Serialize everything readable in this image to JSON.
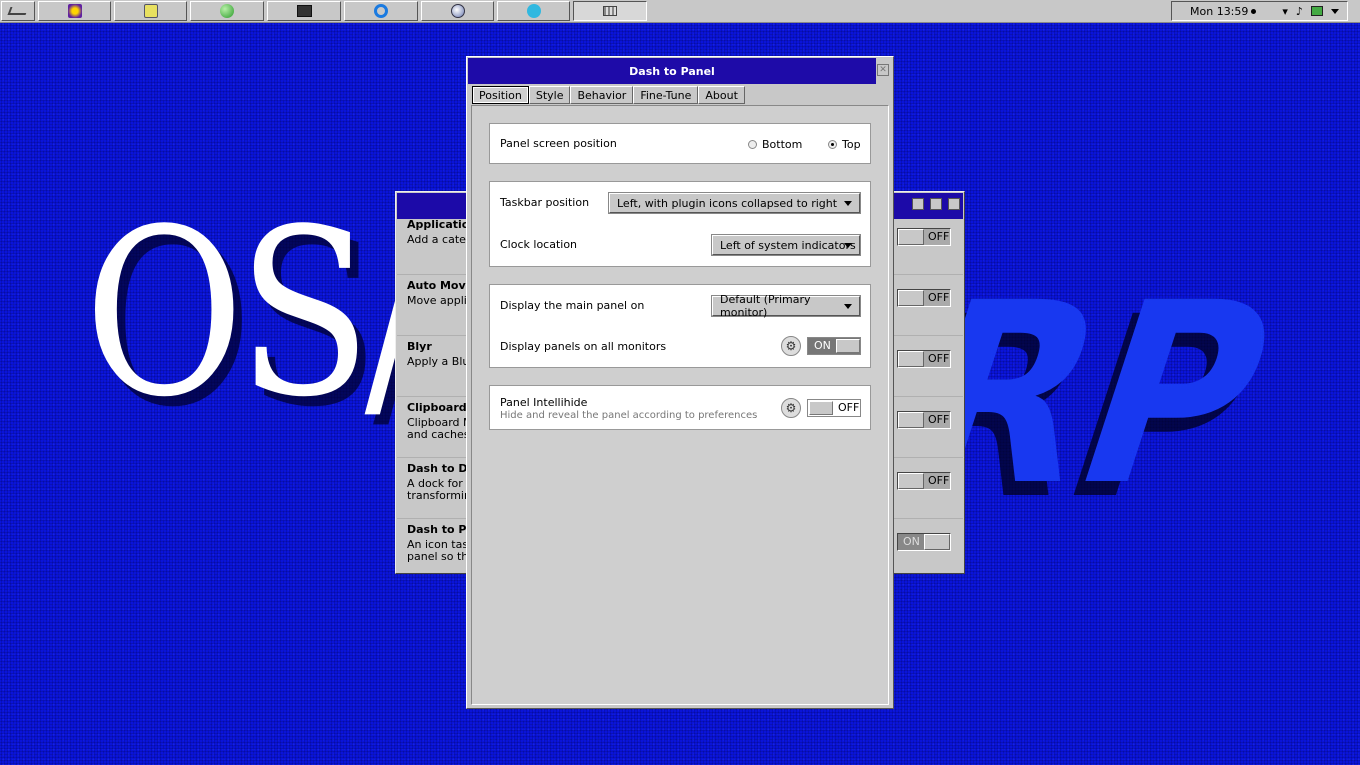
{
  "taskbar": {
    "clock": "Mon 13:59",
    "apps": [
      {
        "icon": "start-menu-icon"
      },
      {
        "icon": "burst-icon"
      },
      {
        "icon": "search-file-icon"
      },
      {
        "icon": "green-ball-icon"
      },
      {
        "icon": "terminal-icon"
      },
      {
        "icon": "power-icon"
      },
      {
        "icon": "globe-icon"
      },
      {
        "icon": "audio-icon"
      },
      {
        "icon": "window-list-icon"
      }
    ]
  },
  "background_window": {
    "extensions": [
      {
        "name": "Applications",
        "desc": "Add a categ",
        "switch": "OFF"
      },
      {
        "name": "Auto Move",
        "desc": "Move applica",
        "switch": "OFF"
      },
      {
        "name": "Blyr",
        "desc": "Apply a Blur",
        "switch": "OFF"
      },
      {
        "name": "Clipboard In",
        "desc": "Clipboard M",
        "desc2": "and caches c",
        "switch": "OFF"
      },
      {
        "name": "Dash to Doc",
        "desc": "A dock for th",
        "desc2": "transforming",
        "switch": "OFF"
      },
      {
        "name": "Dash to Pan",
        "desc": "An icon taskb",
        "desc2": "panel so that",
        "switch": "ON"
      }
    ]
  },
  "window": {
    "title": "Dash to Panel",
    "tabs": [
      "Position",
      "Style",
      "Behavior",
      "Fine-Tune",
      "About"
    ],
    "panel_position": {
      "label": "Panel screen position",
      "options": [
        "Bottom",
        "Top"
      ],
      "selected": "Top"
    },
    "taskbar_position": {
      "label": "Taskbar position",
      "value": "Left, with plugin icons collapsed to right"
    },
    "clock_location": {
      "label": "Clock location",
      "value": "Left of system indicators"
    },
    "main_panel": {
      "label": "Display the main panel on",
      "value": "Default (Primary monitor)"
    },
    "all_monitors": {
      "label": "Display panels on all monitors",
      "switch": "ON"
    },
    "intellihide": {
      "label": "Panel Intellihide",
      "desc": "Hide and reveal the panel according to preferences",
      "switch": "OFF"
    }
  },
  "colors": {
    "desktop": "#0a14d8",
    "titlebar": "#1e0ba8",
    "chrome": "#c8c8c8"
  }
}
